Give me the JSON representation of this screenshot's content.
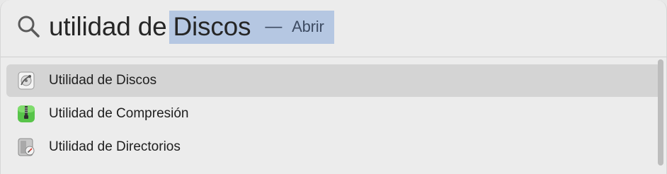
{
  "search": {
    "typed": "utilidad de",
    "completion": "Discos",
    "dash": "—",
    "action": "Abrir"
  },
  "results": [
    {
      "label": "Utilidad de Discos",
      "icon": "disk-utility-icon",
      "selected": true
    },
    {
      "label": "Utilidad de Compresión",
      "icon": "archive-utility-icon",
      "selected": false
    },
    {
      "label": "Utilidad de Directorios",
      "icon": "directory-utility-icon",
      "selected": false
    }
  ],
  "colors": {
    "selection": "#b5c7e2",
    "selected_row": "#d4d4d4"
  }
}
